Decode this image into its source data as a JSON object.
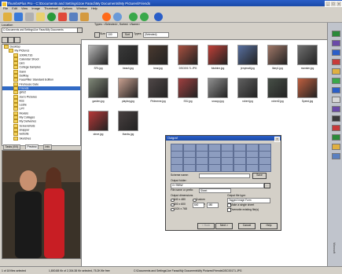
{
  "window": {
    "title": "ThumbsPlus Pro - C:\\Documents and Settings\\Joe Faraci\\My Documents\\My Pictures\\Friends"
  },
  "menu": [
    "File",
    "Edit",
    "View",
    "Image",
    "Thumbnail",
    "Options",
    "Window",
    "Help"
  ],
  "location": {
    "label": "Location",
    "path": "C:\\Documents and Settings\\Joe Faraci\\My Documents"
  },
  "types_line": "Types: <Selected>, Sorted: <Name>",
  "options": {
    "size_label": "Size",
    "size_value": "100",
    "sort_label": "Sort",
    "types_label": "Types",
    "types_value": "(Selected)"
  },
  "tree": [
    {
      "label": "Desktop",
      "level": 0
    },
    {
      "label": "My Pictures",
      "level": 1
    },
    {
      "label": "100MLT16",
      "level": 2
    },
    {
      "label": "Calendar Shoot",
      "level": 2
    },
    {
      "label": "cars",
      "level": 2
    },
    {
      "label": "College Samples",
      "level": 2
    },
    {
      "label": "Dann",
      "level": 2
    },
    {
      "label": "DelRay",
      "level": 2
    },
    {
      "label": "FacePiller Standard Edition",
      "level": 2
    },
    {
      "label": "Firehouse Date",
      "level": 2
    },
    {
      "label": "Friends",
      "level": 2
    },
    {
      "label": "girls2",
      "level": 2
    },
    {
      "label": "Joe's Pictures",
      "level": 2
    },
    {
      "label": "kiss",
      "level": 2
    },
    {
      "label": "Leslie",
      "level": 2
    },
    {
      "label": "LPT",
      "level": 2
    },
    {
      "label": "Models",
      "level": 2
    },
    {
      "label": "My Collages",
      "level": 2
    },
    {
      "label": "My Deliveries",
      "level": 2
    },
    {
      "label": "Screenshots",
      "level": 2
    },
    {
      "label": "snapper",
      "level": 2
    },
    {
      "label": "website",
      "level": 2
    },
    {
      "label": "Sketches",
      "level": 2
    }
  ],
  "panel_tabs": [
    "Tasks (0/0)",
    "Preview",
    "Info"
  ],
  "thumbnails": [
    {
      "name": "SF4.jpg",
      "color": "#b8b8b8"
    },
    {
      "name": "beach.jpg",
      "color": "#3a3a3a"
    },
    {
      "name": "bear.jpg",
      "color": "#4a3a30"
    },
    {
      "name": "DSC00171.JPG",
      "color": "#a85040"
    },
    {
      "name": "fotobine.jpg",
      "color": "#c04038"
    },
    {
      "name": "jerrymatt.jpg",
      "color": "#5870a0"
    },
    {
      "name": "lilary1.jpg",
      "color": "#a07868"
    },
    {
      "name": "monster.jpg",
      "color": "#707070"
    },
    {
      "name": "garden.jpg",
      "color": "#808878"
    },
    {
      "name": "playboy.jpg",
      "color": "#c8a090"
    },
    {
      "name": "Philmeme.jpg",
      "color": "#504848"
    },
    {
      "name": "SSJ.jpg",
      "color": "#a04040"
    },
    {
      "name": "snoopy.jpg",
      "color": "#909090"
    },
    {
      "name": "robert.jpg",
      "color": "#606060"
    },
    {
      "name": "robert2.jpg",
      "color": "#485048"
    },
    {
      "name": "Speed.jpg",
      "color": "#c06040"
    },
    {
      "name": "steve.jpg",
      "color": "#b83838"
    },
    {
      "name": "thanks.jpg",
      "color": "#484040"
    }
  ],
  "dialog": {
    "title": "Outgraf",
    "scheme_label": "Scheme name:",
    "scheme_value": "",
    "save_label": "Save",
    "folder_label": "Output folder:",
    "folder_value": "G:\\TBBW",
    "file_prefix_label": "File name or prefix:",
    "file_prefix_value": "Sheet",
    "dimensions_label": "Output dimensions",
    "dim_options": [
      "640 x 480",
      "800 x 600",
      "1024 x 768"
    ],
    "custom_label": "Custom",
    "custom_w": "640",
    "custom_x": "x",
    "custom_h": "480",
    "filetype_label": "Output file type:",
    "filetype_value": "Tagged Image Form",
    "check1": "Make a single sheet",
    "check2": "Overwrite existing file(s)",
    "back_label": "< Back",
    "next_label": "Next >",
    "cancel_label": "Cancel",
    "help_label": "Help"
  },
  "status": {
    "left": "1 of 18 files selected",
    "mid": "1,800.88 Kb of 2,304.38 Kb selected, 75.2K file free",
    "right": "C:\\Documents and Settings\\Joe Faraci\\My Documents\\My Pictures\\Friends\\DSC00171.JPG"
  },
  "brand": "Microsoft"
}
